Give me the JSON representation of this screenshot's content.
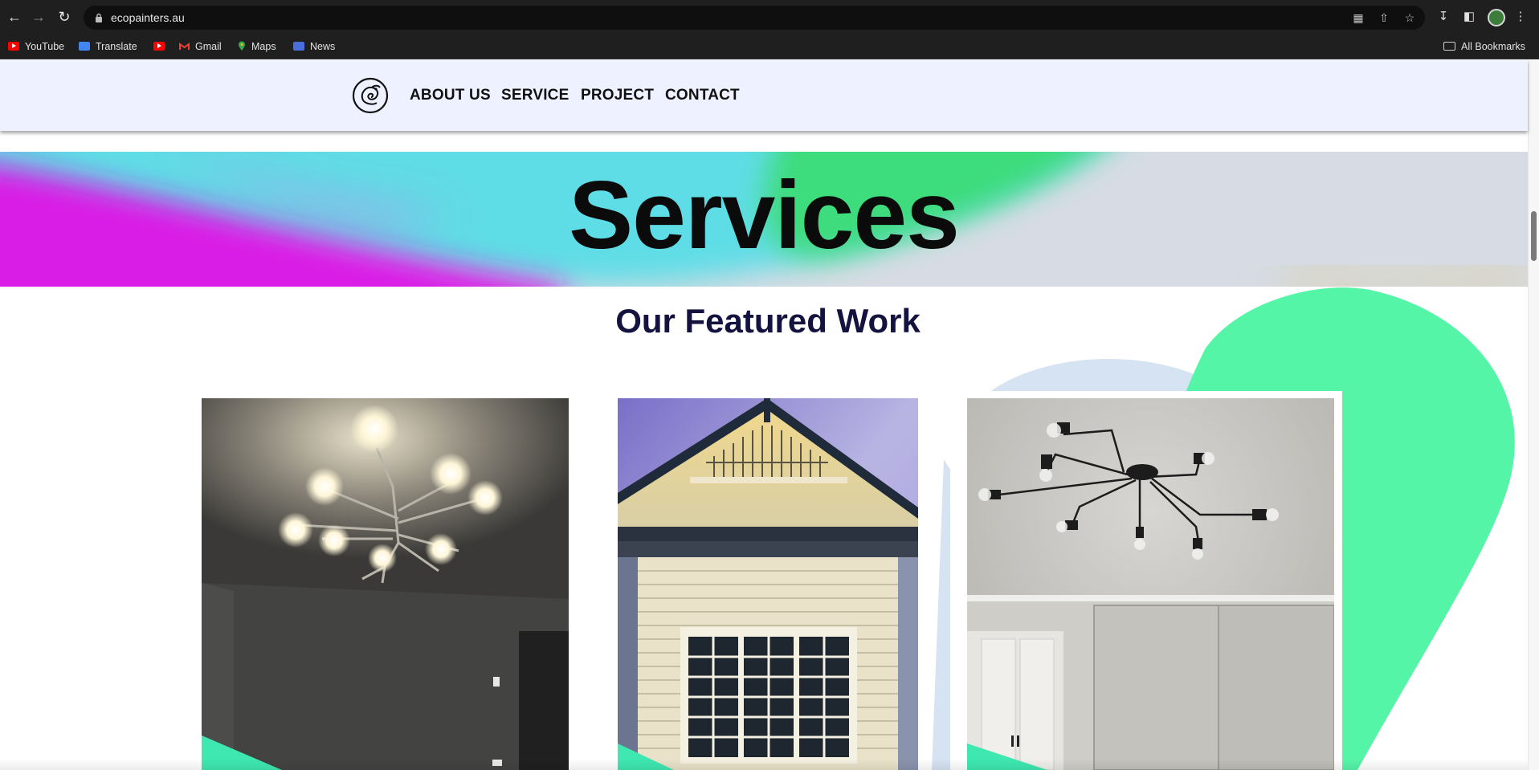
{
  "browser": {
    "url": "ecopainters.au",
    "bookmarks": [
      {
        "label": "YouTube",
        "icon": "youtube-icon"
      },
      {
        "label": "Translate",
        "icon": "translate-icon"
      },
      {
        "label": "",
        "icon": "youtube-icon"
      },
      {
        "label": "Gmail",
        "icon": "gmail-icon"
      },
      {
        "label": "Maps",
        "icon": "maps-icon"
      },
      {
        "label": "News",
        "icon": "news-icon"
      }
    ],
    "all_bookmarks_label": "All Bookmarks"
  },
  "site": {
    "nav": [
      "ABOUT US",
      "SERVICE",
      "PROJECT",
      "CONTACT"
    ],
    "hero_title": "Services",
    "section_title": "Our Featured Work",
    "colors": {
      "header_bg": "#eef1ff",
      "hero_magenta": "#d91fe6",
      "hero_cyan": "#5fdde6",
      "hero_green": "#3ddc7c",
      "accent_mint": "#55f5a8",
      "section_title": "#14123f"
    },
    "cards": [
      {
        "subject": "chandelier-dark-room"
      },
      {
        "subject": "weatherboard-house-gable"
      },
      {
        "subject": "black-light-fixture-white-room"
      }
    ]
  }
}
